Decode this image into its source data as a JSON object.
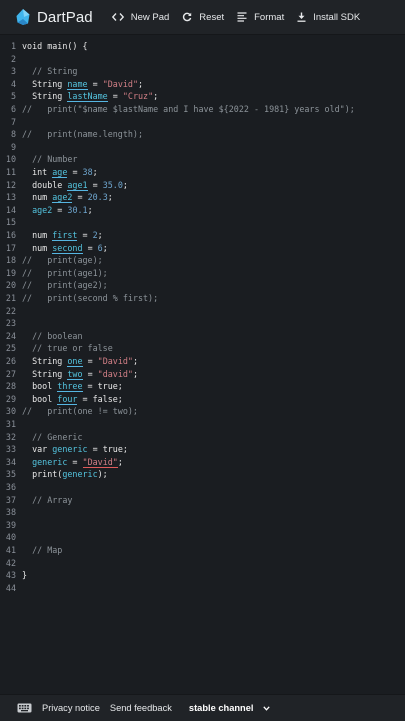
{
  "app": {
    "title": "DartPad"
  },
  "toolbar": {
    "new_pad": "New Pad",
    "reset": "Reset",
    "format": "Format",
    "install_sdk": "Install SDK"
  },
  "colors": {
    "background": "#1a1d21",
    "bar": "#202327",
    "identifier": "#54c4df",
    "string": "#d27f86",
    "number": "#6fa6cf",
    "comment": "#8c9399"
  },
  "editor": {
    "lines": [
      {
        "n": "1",
        "tokens": [
          [
            "void main() {",
            ""
          ]
        ]
      },
      {
        "n": "2",
        "tokens": []
      },
      {
        "n": "3",
        "tokens": [
          [
            "  // String",
            "com"
          ]
        ]
      },
      {
        "n": "4",
        "tokens": [
          [
            "  String ",
            ""
          ],
          [
            "name",
            "id u-blue"
          ],
          [
            " = ",
            ""
          ],
          [
            "\"David\"",
            "str"
          ],
          [
            ";",
            ""
          ]
        ]
      },
      {
        "n": "5",
        "tokens": [
          [
            "  String ",
            ""
          ],
          [
            "lastName",
            "id u-blue"
          ],
          [
            " = ",
            ""
          ],
          [
            "\"Cruz\"",
            "str"
          ],
          [
            ";",
            ""
          ]
        ]
      },
      {
        "n": "6",
        "tokens": [
          [
            "//   print(\"$name $lastName and I have ${2022 - 1981} years old\");",
            "com"
          ]
        ]
      },
      {
        "n": "7",
        "tokens": []
      },
      {
        "n": "8",
        "tokens": [
          [
            "//   print(name.length);",
            "com"
          ]
        ]
      },
      {
        "n": "9",
        "tokens": []
      },
      {
        "n": "10",
        "tokens": [
          [
            "  // Number",
            "com"
          ]
        ]
      },
      {
        "n": "11",
        "tokens": [
          [
            "  int ",
            ""
          ],
          [
            "age",
            "id u-blue"
          ],
          [
            " = ",
            ""
          ],
          [
            "38",
            "num"
          ],
          [
            ";",
            ""
          ]
        ]
      },
      {
        "n": "12",
        "tokens": [
          [
            "  double ",
            ""
          ],
          [
            "age1",
            "id u-blue"
          ],
          [
            " = ",
            ""
          ],
          [
            "35.0",
            "num"
          ],
          [
            ";",
            ""
          ]
        ]
      },
      {
        "n": "13",
        "tokens": [
          [
            "  num ",
            ""
          ],
          [
            "age2",
            "id u-blue"
          ],
          [
            " = ",
            ""
          ],
          [
            "20.3",
            "num"
          ],
          [
            ";",
            ""
          ]
        ]
      },
      {
        "n": "14",
        "tokens": [
          [
            "  ",
            ""
          ],
          [
            "age2",
            "var"
          ],
          [
            " = ",
            ""
          ],
          [
            "30.1",
            "num"
          ],
          [
            ";",
            ""
          ]
        ]
      },
      {
        "n": "15",
        "tokens": []
      },
      {
        "n": "16",
        "tokens": [
          [
            "  num ",
            ""
          ],
          [
            "first",
            "id u-blue"
          ],
          [
            " = ",
            ""
          ],
          [
            "2",
            "num"
          ],
          [
            ";",
            ""
          ]
        ]
      },
      {
        "n": "17",
        "tokens": [
          [
            "  num ",
            ""
          ],
          [
            "second",
            "id u-blue"
          ],
          [
            " = ",
            ""
          ],
          [
            "6",
            "num"
          ],
          [
            ";",
            ""
          ]
        ]
      },
      {
        "n": "18",
        "tokens": [
          [
            "//   print(age);",
            "com"
          ]
        ]
      },
      {
        "n": "19",
        "tokens": [
          [
            "//   print(age1);",
            "com"
          ]
        ]
      },
      {
        "n": "20",
        "tokens": [
          [
            "//   print(age2);",
            "com"
          ]
        ]
      },
      {
        "n": "21",
        "tokens": [
          [
            "//   print(second % first);",
            "com"
          ]
        ]
      },
      {
        "n": "22",
        "tokens": []
      },
      {
        "n": "23",
        "tokens": []
      },
      {
        "n": "24",
        "tokens": [
          [
            "  // boolean",
            "com"
          ]
        ]
      },
      {
        "n": "25",
        "tokens": [
          [
            "  // true or false",
            "com"
          ]
        ]
      },
      {
        "n": "26",
        "tokens": [
          [
            "  String ",
            ""
          ],
          [
            "one",
            "id u-blue"
          ],
          [
            " = ",
            ""
          ],
          [
            "\"David\"",
            "str"
          ],
          [
            ";",
            ""
          ]
        ]
      },
      {
        "n": "27",
        "tokens": [
          [
            "  String ",
            ""
          ],
          [
            "two",
            "id u-blue"
          ],
          [
            " = ",
            ""
          ],
          [
            "\"david\"",
            "str"
          ],
          [
            ";",
            ""
          ]
        ]
      },
      {
        "n": "28",
        "tokens": [
          [
            "  bool ",
            ""
          ],
          [
            "three",
            "id u-blue"
          ],
          [
            " = true;",
            ""
          ]
        ]
      },
      {
        "n": "29",
        "tokens": [
          [
            "  bool ",
            ""
          ],
          [
            "four",
            "id u-blue"
          ],
          [
            " = false;",
            ""
          ]
        ]
      },
      {
        "n": "30",
        "tokens": [
          [
            "//   print(one != two);",
            "com"
          ]
        ]
      },
      {
        "n": "31",
        "tokens": []
      },
      {
        "n": "32",
        "tokens": [
          [
            "  // Generic",
            "com"
          ]
        ]
      },
      {
        "n": "33",
        "tokens": [
          [
            "  var ",
            ""
          ],
          [
            "generic",
            "id"
          ],
          [
            " = true;",
            ""
          ]
        ]
      },
      {
        "n": "34",
        "tokens": [
          [
            "  ",
            ""
          ],
          [
            "generic",
            "var"
          ],
          [
            " = ",
            ""
          ],
          [
            "\"David\"",
            "str u-red"
          ],
          [
            ";",
            ""
          ]
        ]
      },
      {
        "n": "35",
        "tokens": [
          [
            "  print(",
            ""
          ],
          [
            "generic",
            "var"
          ],
          [
            ");",
            ""
          ]
        ]
      },
      {
        "n": "36",
        "tokens": []
      },
      {
        "n": "37",
        "tokens": [
          [
            "  // Array",
            "com"
          ]
        ]
      },
      {
        "n": "38",
        "tokens": []
      },
      {
        "n": "39",
        "tokens": []
      },
      {
        "n": "40",
        "tokens": []
      },
      {
        "n": "41",
        "tokens": [
          [
            "  // Map",
            "com"
          ]
        ]
      },
      {
        "n": "42",
        "tokens": []
      },
      {
        "n": "43",
        "tokens": [
          [
            "}",
            ""
          ]
        ]
      },
      {
        "n": "44",
        "tokens": []
      }
    ]
  },
  "footer": {
    "keyboard_icon": "keyboard-icon",
    "privacy": "Privacy notice",
    "feedback": "Send feedback",
    "channel": "stable channel"
  }
}
